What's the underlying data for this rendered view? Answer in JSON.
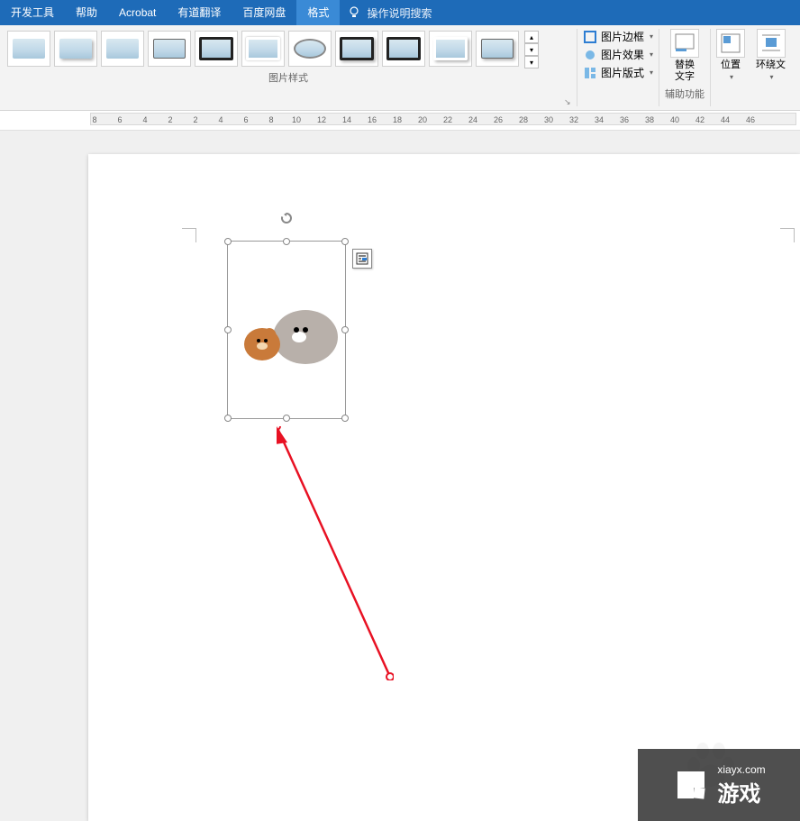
{
  "tabs": {
    "items": [
      "开发工具",
      "帮助",
      "Acrobat",
      "有道翻译",
      "百度网盘",
      "格式"
    ],
    "active_index": 5
  },
  "search": {
    "placeholder": "操作说明搜索"
  },
  "ribbon": {
    "styles_label": "图片样式",
    "border_label": "图片边框",
    "effect_label": "图片效果",
    "layout_label": "图片版式",
    "alt_text_label": "替换\n文字",
    "accessibility_label": "辅助功能",
    "position_label": "位置",
    "wrap_label": "环绕文"
  },
  "ruler": {
    "ticks": [
      "8",
      "6",
      "4",
      "2",
      "2",
      "4",
      "6",
      "8",
      "10",
      "12",
      "14",
      "16",
      "18",
      "20",
      "22",
      "24",
      "26",
      "28",
      "30",
      "32",
      "34",
      "36",
      "38",
      "40",
      "42",
      "44",
      "46"
    ]
  },
  "watermark": {
    "url": "xiayx.com",
    "name": "游戏"
  }
}
